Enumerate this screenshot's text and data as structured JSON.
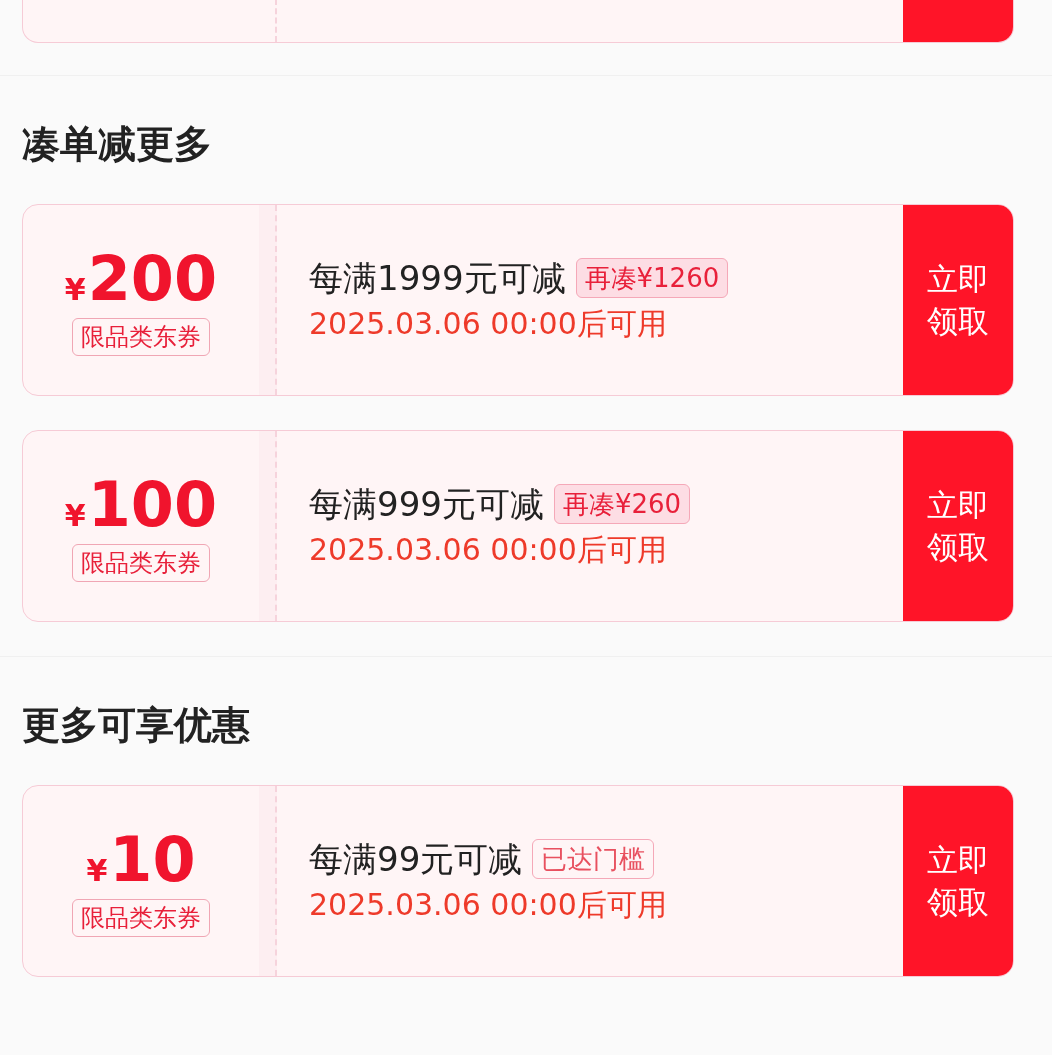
{
  "sections": [
    {
      "title": "凑单减更多",
      "coupons": [
        {
          "currency": "¥",
          "amount": "200",
          "scope": "限品类东券",
          "condition": "每满1999元可减",
          "tag": {
            "kind": "gap",
            "text": "再凑¥1260"
          },
          "valid_from": "2025.03.06 00:00后可用",
          "button": [
            "立即",
            "领取"
          ]
        },
        {
          "currency": "¥",
          "amount": "100",
          "scope": "限品类东券",
          "condition": "每满999元可减",
          "tag": {
            "kind": "gap",
            "text": "再凑¥260"
          },
          "valid_from": "2025.03.06 00:00后可用",
          "button": [
            "立即",
            "领取"
          ]
        }
      ]
    },
    {
      "title": "更多可享优惠",
      "coupons": [
        {
          "currency": "¥",
          "amount": "10",
          "scope": "限品类东券",
          "condition": "每满99元可减",
          "tag": {
            "kind": "reached",
            "text": "已达门槛"
          },
          "valid_from": "2025.03.06 00:00后可用",
          "button": [
            "立即",
            "领取"
          ]
        }
      ]
    }
  ]
}
